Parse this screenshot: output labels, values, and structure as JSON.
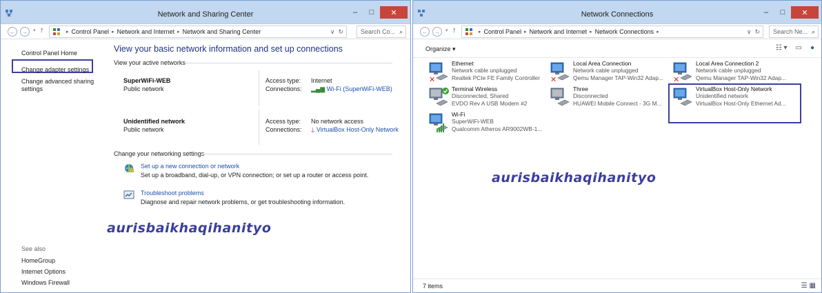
{
  "left_window": {
    "title": "Network and Sharing Center",
    "address": [
      "Control Panel",
      "Network and Internet",
      "Network and Sharing Center"
    ],
    "search_placeholder": "Search Co...",
    "sidebar": {
      "home": "Control Panel Home",
      "links": [
        "Change adapter settings",
        "Change advanced sharing settings"
      ],
      "see_also_label": "See also",
      "see_also": [
        "HomeGroup",
        "Internet Options",
        "Windows Firewall"
      ]
    },
    "heading": "View your basic network information and set up connections",
    "active_networks_label": "View your active networks",
    "networks": [
      {
        "name": "SuperWiFi-WEB",
        "type": "Public network",
        "access_label": "Access type:",
        "access": "Internet",
        "conn_label": "Connections:",
        "conn": "Wi-Fi (SuperWiFi-WEB)"
      },
      {
        "name": "Unidentified network",
        "type": "Public network",
        "access_label": "Access type:",
        "access": "No network access",
        "conn_label": "Connections:",
        "conn": "VirtualBox Host-Only Network"
      }
    ],
    "change_settings_label": "Change your networking settings",
    "tasks": [
      {
        "link": "Set up a new connection or network",
        "desc": "Set up a broadband, dial-up, or VPN connection; or set up a router or access point."
      },
      {
        "link": "Troubleshoot problems",
        "desc": "Diagnose and repair network problems, or get troubleshooting information."
      }
    ],
    "watermark": "aurisbaikhaqihanityo"
  },
  "right_window": {
    "title": "Network Connections",
    "address": [
      "Control Panel",
      "Network and Internet",
      "Network Connections"
    ],
    "search_placeholder": "Search Ne...",
    "organize": "Organize ▾",
    "connections": [
      {
        "name": "Ethernet",
        "status": "Network cable unplugged",
        "device": "Realtek PCIe FE Family Controller",
        "badge": "x"
      },
      {
        "name": "Local Area Connection",
        "status": "Network cable unplugged",
        "device": "Qemu Manager TAP-Win32 Adap...",
        "badge": "x"
      },
      {
        "name": "Local Area Connection 2",
        "status": "Network cable unplugged",
        "device": "Qemu Manager TAP-Win32 Adap...",
        "badge": "x"
      },
      {
        "name": "Terminal Wireless",
        "status": "Disconnected, Shared",
        "device": "EVDO Rev A USB Modem #2",
        "badge": "check"
      },
      {
        "name": "Three",
        "status": "Disconnected",
        "device": "HUAWEI Mobile Connect - 3G M...",
        "badge": "none"
      },
      {
        "name": "VirtualBox Host-Only Network",
        "status": "Unidentified network",
        "device": "VirtualBox Host-Only Ethernet Ad...",
        "badge": "none"
      },
      {
        "name": "Wi-Fi",
        "status": "SuperWiFi-WEB",
        "device": "Qualcomm Atheros AR9002WB-1...",
        "badge": "signal"
      }
    ],
    "items_count": "7 items",
    "watermark": "aurisbaikhaqihanityo"
  },
  "colors": {
    "accent": "#1e3287",
    "link": "#1c4fa8",
    "highlight": "#3a3fa0",
    "titlebar": "#c2d7f0",
    "close": "#c7453a"
  }
}
